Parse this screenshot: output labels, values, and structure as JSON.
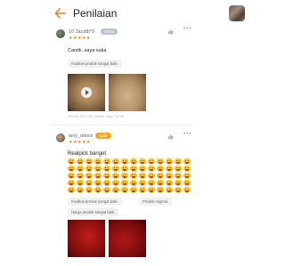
{
  "header": {
    "title": "Penilaian"
  },
  "reviews": [
    {
      "username": "10`2acd8t*9",
      "badge": "Silver",
      "stars": "★★★★★",
      "text": "Cantik, saya suka",
      "tags": [
        "Kualitas produk sangat baik."
      ],
      "meta": "2023-07-21 17:00 | Variasi: mika, Cut 38"
    },
    {
      "username": "amy_dance",
      "badge": "Gold",
      "stars": "★★★★★",
      "text": "Realpick banget",
      "tags": [
        "Kualitas produk sangat baik.",
        "Produk original.",
        "Harga produk sangat baik."
      ]
    }
  ],
  "icons": {
    "back": "back-arrow-icon",
    "like": "thumbs-up-icon",
    "more": "more-icon",
    "play": "play-icon"
  },
  "colors": {
    "accent": "#f07c1b",
    "gold_badge": "#f5a623",
    "silver_badge": "#b9c2cf"
  }
}
